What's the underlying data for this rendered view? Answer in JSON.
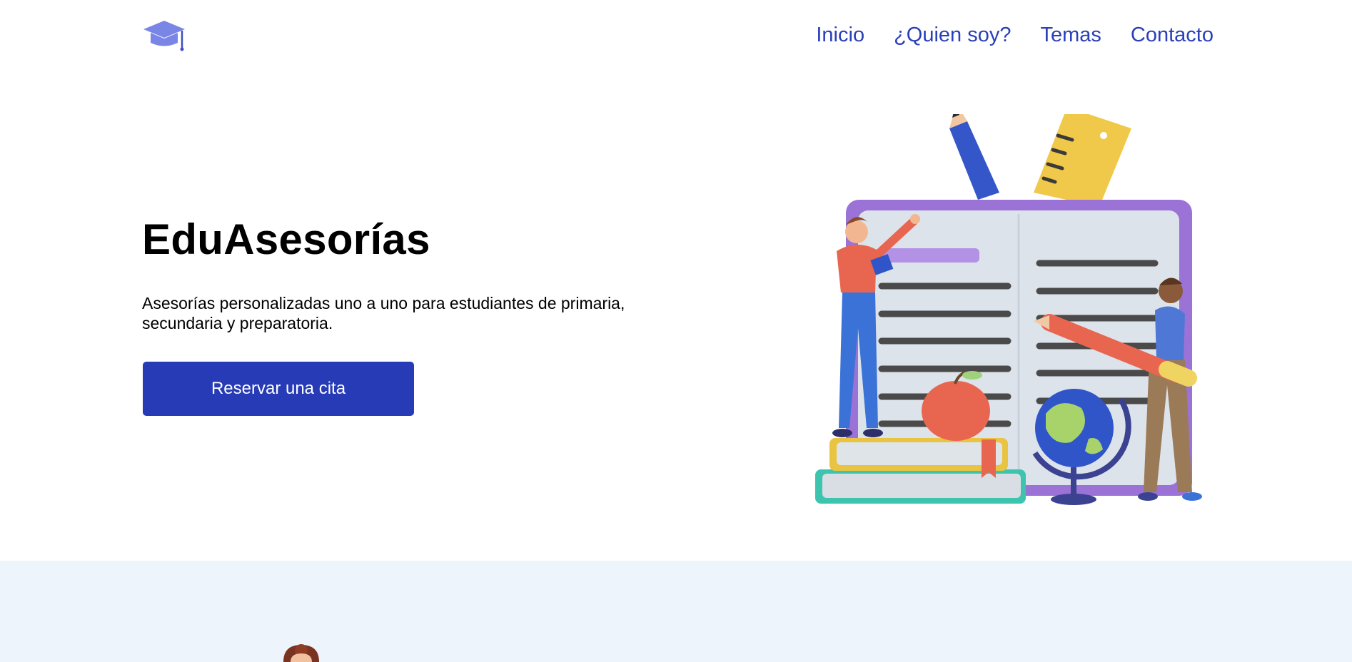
{
  "header": {
    "logo_icon": "graduation-cap-icon",
    "nav": [
      {
        "label": "Inicio"
      },
      {
        "label": "¿Quien soy?"
      },
      {
        "label": "Temas"
      },
      {
        "label": "Contacto"
      }
    ]
  },
  "hero": {
    "title": "EduAsesorías",
    "subtitle": "Asesorías personalizadas uno a uno para estudiantes de primaria, secundaria y preparatoria.",
    "cta_label": "Reservar una cita",
    "illustration": "education-illustration"
  },
  "colors": {
    "accent": "#263bb5",
    "nav_link": "#2a3fb8",
    "logo": "#7a86e6",
    "section_band": "#eef4fc"
  }
}
